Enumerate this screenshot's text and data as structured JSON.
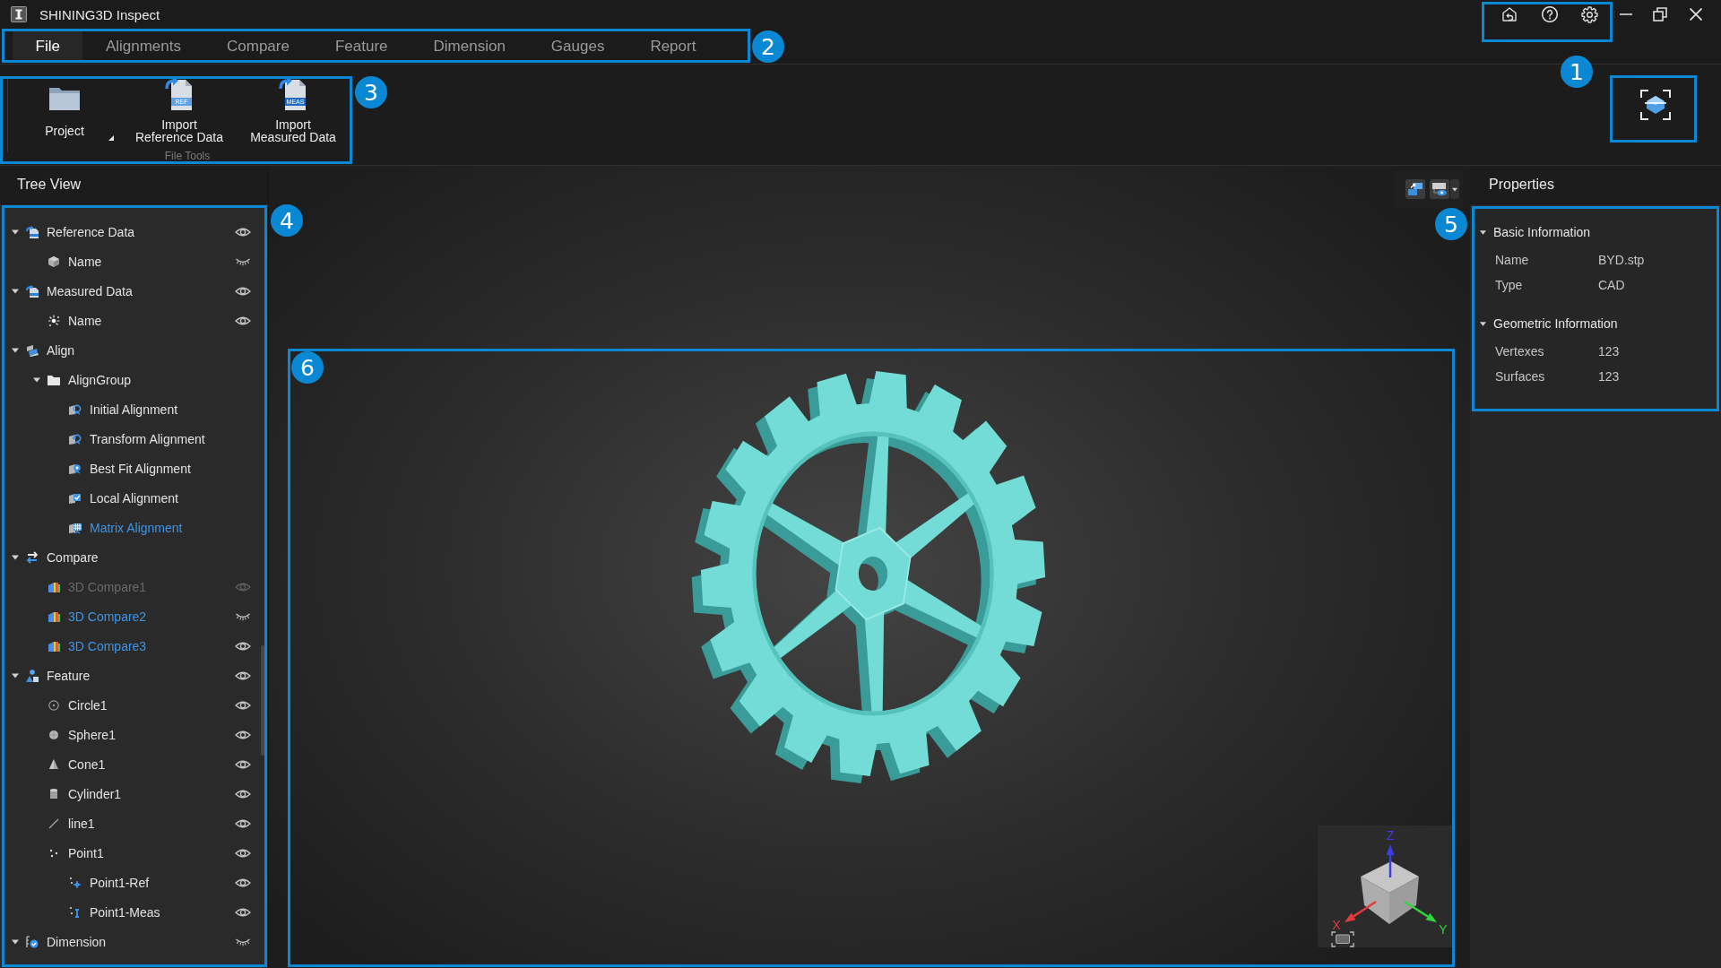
{
  "window": {
    "title": "SHINING3D Inspect"
  },
  "menu_tabs": [
    {
      "label": "File",
      "selected": true
    },
    {
      "label": "Alignments",
      "selected": false
    },
    {
      "label": "Compare",
      "selected": false
    },
    {
      "label": "Feature",
      "selected": false
    },
    {
      "label": "Dimension",
      "selected": false
    },
    {
      "label": "Gauges",
      "selected": false
    },
    {
      "label": "Report",
      "selected": false
    }
  ],
  "ribbon": {
    "group_label": "File Tools",
    "buttons": [
      {
        "kind": "project",
        "label": "Project",
        "dropdown": true
      },
      {
        "kind": "reference",
        "label": "Import Reference Data",
        "tag": "REF"
      },
      {
        "kind": "measured",
        "label": "Import Measured Data",
        "tag": "MEAS"
      }
    ]
  },
  "tree_view": {
    "title": "Tree View",
    "items": [
      {
        "label": "Reference Data",
        "kind": "reference",
        "expanded": true,
        "visible": true,
        "selected": false,
        "disabled": false,
        "children": [
          {
            "label": "Name",
            "kind": "mesh",
            "visible": false,
            "selected": false,
            "disabled": false
          }
        ]
      },
      {
        "label": "Measured Data",
        "kind": "measured",
        "expanded": true,
        "visible": true,
        "selected": false,
        "disabled": false,
        "children": [
          {
            "label": "Name",
            "kind": "cloud",
            "visible": true,
            "selected": false,
            "disabled": false
          }
        ]
      },
      {
        "label": "Align",
        "kind": "align",
        "expanded": true,
        "selected": false,
        "disabled": false,
        "children": [
          {
            "label": "AlignGroup",
            "kind": "folder",
            "expanded": true,
            "selected": false,
            "disabled": false,
            "children": [
              {
                "label": "Initial Alignment",
                "kind": "initial",
                "selected": false,
                "disabled": false
              },
              {
                "label": "Transform Alignment",
                "kind": "transform",
                "selected": false,
                "disabled": false
              },
              {
                "label": "Best Fit Alignment",
                "kind": "bestfit",
                "selected": false,
                "disabled": false
              },
              {
                "label": "Local Alignment",
                "kind": "local",
                "selected": false,
                "disabled": false
              },
              {
                "label": "Matrix Alignment",
                "kind": "matrix",
                "selected": true,
                "disabled": false
              }
            ]
          }
        ]
      },
      {
        "label": "Compare",
        "kind": "compare",
        "expanded": true,
        "selected": false,
        "disabled": false,
        "children": [
          {
            "label": "3D Compare1",
            "kind": "compare3d",
            "visible": true,
            "selected": false,
            "disabled": true
          },
          {
            "label": "3D Compare2",
            "kind": "compare3d",
            "visible": false,
            "selected": true,
            "disabled": false
          },
          {
            "label": "3D Compare3",
            "kind": "compare3d",
            "visible": true,
            "selected": true,
            "disabled": false
          }
        ]
      },
      {
        "label": "Feature",
        "kind": "feature",
        "expanded": true,
        "visible": true,
        "selected": false,
        "disabled": false,
        "children": [
          {
            "label": "Circle1",
            "kind": "circle",
            "visible": true,
            "selected": false,
            "disabled": false
          },
          {
            "label": "Sphere1",
            "kind": "sphere",
            "visible": true,
            "selected": false,
            "disabled": false
          },
          {
            "label": "Cone1",
            "kind": "cone",
            "visible": true,
            "selected": false,
            "disabled": false
          },
          {
            "label": "Cylinder1",
            "kind": "cylinder",
            "visible": true,
            "selected": false,
            "disabled": false
          },
          {
            "label": "line1",
            "kind": "line",
            "visible": true,
            "selected": false,
            "disabled": false
          },
          {
            "label": "Point1",
            "kind": "point",
            "visible": true,
            "selected": false,
            "disabled": false,
            "children": [
              {
                "label": "Point1-Ref",
                "kind": "pointref",
                "visible": true,
                "selected": false,
                "disabled": false
              },
              {
                "label": "Point1-Meas",
                "kind": "pointmeas",
                "visible": true,
                "selected": false,
                "disabled": false
              }
            ]
          }
        ]
      },
      {
        "label": "Dimension",
        "kind": "dimension",
        "expanded": true,
        "visible": false,
        "selected": false,
        "disabled": false
      }
    ]
  },
  "properties": {
    "title": "Properties",
    "sections": [
      {
        "title": "Basic Information",
        "expanded": true,
        "rows": [
          {
            "label": "Name",
            "value": "BYD.stp"
          },
          {
            "label": "Type",
            "value": "CAD"
          }
        ]
      },
      {
        "title": "Geometric Information",
        "expanded": true,
        "rows": [
          {
            "label": "Vertexes",
            "value": "123"
          },
          {
            "label": "Surfaces",
            "value": "123"
          }
        ]
      }
    ]
  },
  "viewport": {
    "axes": [
      {
        "label": "X",
        "color": "#e23b3b"
      },
      {
        "label": "Y",
        "color": "#2fd63a"
      },
      {
        "label": "Z",
        "color": "#3d3de6"
      }
    ]
  },
  "callouts": [
    {
      "number": "1"
    },
    {
      "number": "2"
    },
    {
      "number": "3"
    },
    {
      "number": "4"
    },
    {
      "number": "5"
    },
    {
      "number": "6"
    }
  ]
}
